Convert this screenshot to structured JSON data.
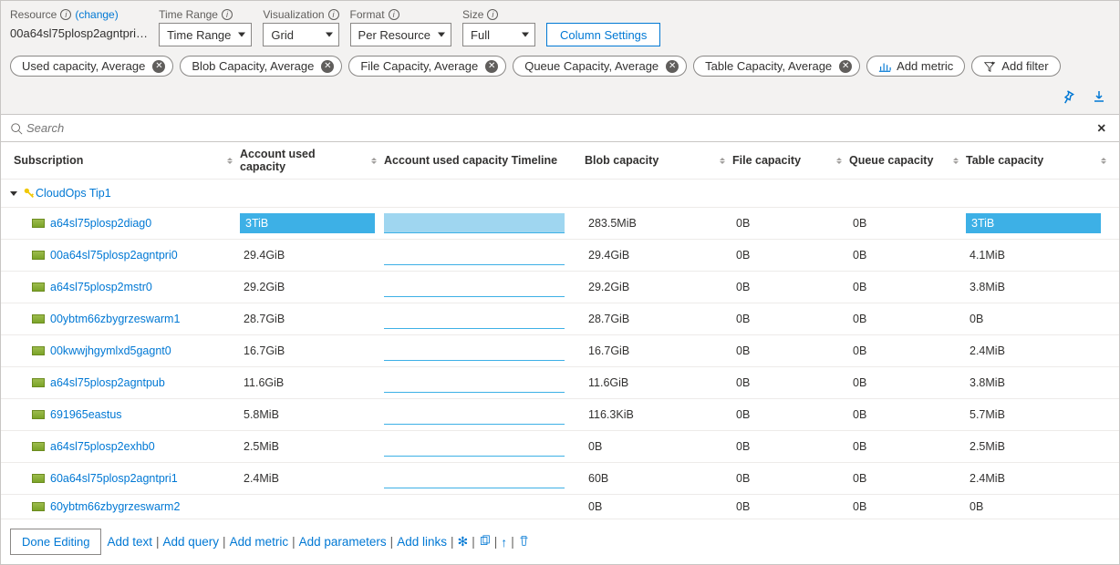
{
  "toolbar": {
    "resource_label": "Resource",
    "change_label": "(change)",
    "resource_value": "00a64sl75plosp2agntpri…",
    "time_range_label": "Time Range",
    "time_range_value": "Time Range",
    "visualization_label": "Visualization",
    "visualization_value": "Grid",
    "format_label": "Format",
    "format_value": "Per Resource",
    "size_label": "Size",
    "size_value": "Full",
    "column_settings": "Column Settings"
  },
  "chips": [
    {
      "label": "Used capacity, Average"
    },
    {
      "label": "Blob Capacity, Average"
    },
    {
      "label": "File Capacity, Average"
    },
    {
      "label": "Queue Capacity, Average"
    },
    {
      "label": "Table Capacity, Average"
    }
  ],
  "add_metric": "Add metric",
  "add_filter": "Add filter",
  "search_placeholder": "Search",
  "columns": {
    "subscription": "Subscription",
    "used": "Account used capacity",
    "timeline": "Account used capacity Timeline",
    "blob": "Blob capacity",
    "file": "File capacity",
    "queue": "Queue capacity",
    "table": "Table capacity"
  },
  "group_name": "CloudOps Tip1",
  "rows": [
    {
      "name": "a64sl75plosp2diag0",
      "used": "3TiB",
      "used_full": true,
      "tl": 100,
      "blob": "283.5MiB",
      "file": "0B",
      "queue": "0B",
      "table": "3TiB",
      "table_full": true
    },
    {
      "name": "00a64sl75plosp2agntpri0",
      "used": "29.4GiB",
      "tl": 48,
      "blob": "29.4GiB",
      "file": "0B",
      "queue": "0B",
      "table": "4.1MiB"
    },
    {
      "name": "a64sl75plosp2mstr0",
      "used": "29.2GiB",
      "tl": 47,
      "blob": "29.2GiB",
      "file": "0B",
      "queue": "0B",
      "table": "3.8MiB"
    },
    {
      "name": "00ybtm66zbygrzeswarm1",
      "used": "28.7GiB",
      "tl": 46,
      "blob": "28.7GiB",
      "file": "0B",
      "queue": "0B",
      "table": "0B"
    },
    {
      "name": "00kwwjhgymlxd5gagnt0",
      "used": "16.7GiB",
      "tl": 45,
      "blob": "16.7GiB",
      "file": "0B",
      "queue": "0B",
      "table": "2.4MiB"
    },
    {
      "name": "a64sl75plosp2agntpub",
      "used": "11.6GiB",
      "tl": 44,
      "blob": "11.6GiB",
      "file": "0B",
      "queue": "0B",
      "table": "3.8MiB"
    },
    {
      "name": "691965eastus",
      "used": "5.8MiB",
      "tl": 43,
      "blob": "116.3KiB",
      "file": "0B",
      "queue": "0B",
      "table": "5.7MiB"
    },
    {
      "name": "a64sl75plosp2exhb0",
      "used": "2.5MiB",
      "tl": 42,
      "blob": "0B",
      "file": "0B",
      "queue": "0B",
      "table": "2.5MiB"
    },
    {
      "name": "60a64sl75plosp2agntpri1",
      "used": "2.4MiB",
      "tl": 41,
      "blob": "60B",
      "file": "0B",
      "queue": "0B",
      "table": "2.4MiB"
    },
    {
      "name": "60ybtm66zbygrzeswarm2",
      "used": "",
      "tl": 0,
      "blob": "0B",
      "file": "0B",
      "queue": "0B",
      "table": "0B"
    }
  ],
  "footer": {
    "done_editing": "Done Editing",
    "add_text": "Add text",
    "add_query": "Add query",
    "add_metric": "Add metric",
    "add_parameters": "Add parameters",
    "add_links": "Add links"
  }
}
